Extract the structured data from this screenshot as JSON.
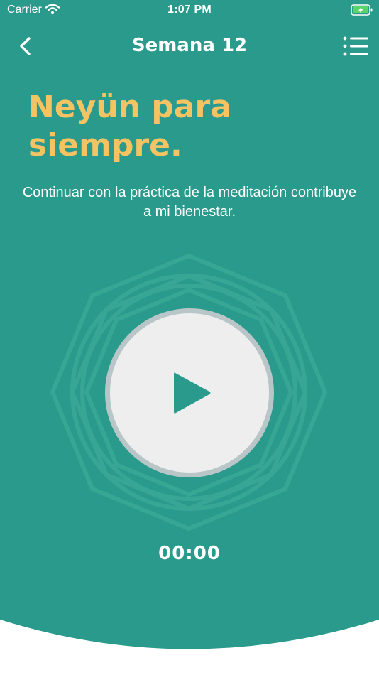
{
  "colors": {
    "background": "#2a9a8c",
    "accent_yellow": "#f5c362",
    "play_button_bg": "#eeeeee",
    "play_button_ring": "#b9c6c7",
    "play_icon": "#2a9a8c"
  },
  "status_bar": {
    "carrier": "Carrier",
    "time": "1:07 PM",
    "icons": [
      "wifi-icon",
      "battery-charging-icon"
    ]
  },
  "nav": {
    "title": "Semana 12",
    "back_icon": "chevron-left-icon",
    "menu_icon": "list-icon"
  },
  "content": {
    "headline": "Neyün para siempre.",
    "subtitle": "Continuar con la práctica de la meditación contribuye a mi bienestar."
  },
  "player": {
    "play_icon": "play-icon",
    "timer": "00:00"
  }
}
